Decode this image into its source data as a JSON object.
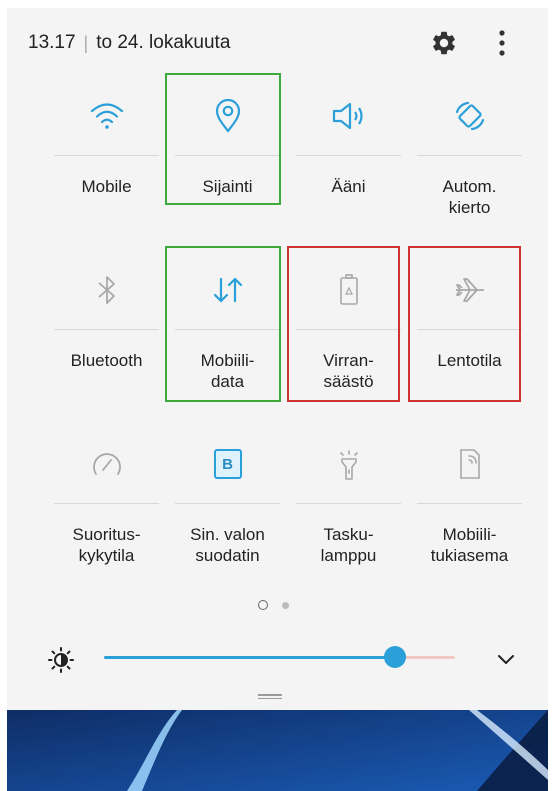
{
  "status": {
    "time": "13.17",
    "date": "to 24. lokakuuta"
  },
  "header": {
    "settings_icon": "gear-icon",
    "more_icon": "more-vertical-icon"
  },
  "tiles": [
    {
      "label": "Mobile",
      "icon": "wifi-icon",
      "active": true
    },
    {
      "label": "Sijainti",
      "icon": "location-pin-icon",
      "active": true
    },
    {
      "label": "Ääni",
      "icon": "speaker-icon",
      "active": true
    },
    {
      "label": "Autom.\nkierto",
      "icon": "auto-rotate-icon",
      "active": true
    },
    {
      "label": "Bluetooth",
      "icon": "bluetooth-icon",
      "active": false
    },
    {
      "label": "Mobiili-\ndata",
      "icon": "mobile-data-icon",
      "active": true
    },
    {
      "label": "Virran-\nsäästö",
      "icon": "power-saving-icon",
      "active": false
    },
    {
      "label": "Lentotila",
      "icon": "airplane-icon",
      "active": false
    },
    {
      "label": "Suoritus-\nkykytila",
      "icon": "performance-mode-icon",
      "active": false
    },
    {
      "label": "Sin. valon\nsuodatin",
      "icon": "blue-light-filter-icon",
      "active": true
    },
    {
      "label": "Tasku-\nlamppu",
      "icon": "flashlight-icon",
      "active": false
    },
    {
      "label": "Mobiili-\ntukiasema",
      "icon": "mobile-hotspot-icon",
      "active": false
    }
  ],
  "blue_light_badge": "B",
  "pagination": {
    "current": 1,
    "total": 2
  },
  "brightness": {
    "level": 0.83,
    "icon": "brightness-icon",
    "expand_icon": "chevron-down-icon"
  },
  "colors": {
    "accent": "#2a9fd8",
    "inactive": "#9e9e9e",
    "highlight_green": "#3daa3d",
    "highlight_red": "#d03333"
  }
}
